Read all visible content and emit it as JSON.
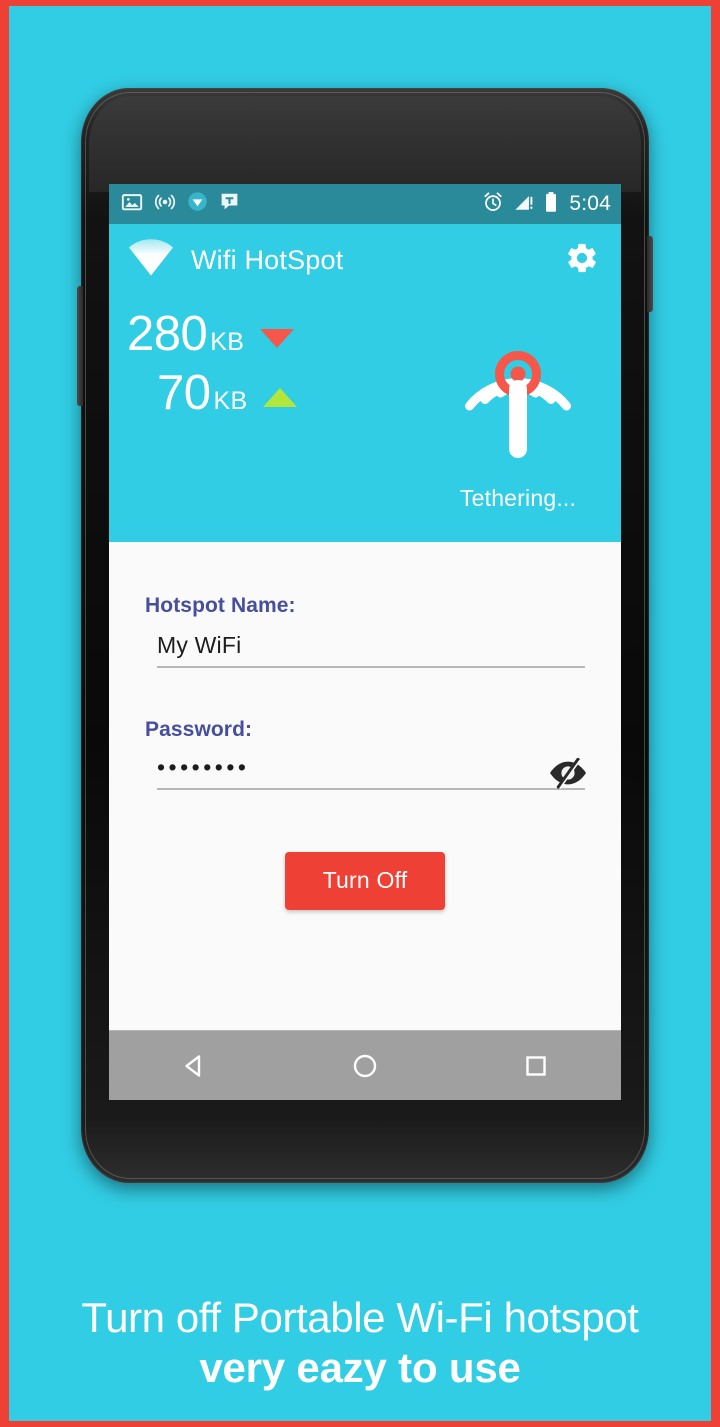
{
  "frame": {
    "border_color": "#EE4035",
    "background_color": "#31CDE4"
  },
  "status_bar": {
    "background_color": "#2B8A99",
    "time": "5:04",
    "left_icons": [
      {
        "name": "image-icon",
        "label": "Screenshot"
      },
      {
        "name": "hotspot-icon",
        "label": "Portable hotspot active"
      },
      {
        "name": "wifi-circle-icon",
        "label": "Wi-Fi"
      },
      {
        "name": "chat-t-icon",
        "label": "T message"
      }
    ],
    "right_icons": [
      {
        "name": "alarm-icon",
        "label": "Alarm set"
      },
      {
        "name": "signal-warning-icon",
        "label": "Mobile signal, no service"
      },
      {
        "name": "battery-icon",
        "label": "Battery"
      }
    ]
  },
  "app_bar": {
    "title": "Wifi HotSpot",
    "logo_icon": "wifi-triangle-icon",
    "settings_icon": "gear-icon",
    "background_color": "#31CDE4"
  },
  "hero": {
    "download": {
      "value": "280",
      "unit": "KB",
      "direction": "down",
      "arrow_color": "#F5574B"
    },
    "upload": {
      "value": "70",
      "unit": "KB",
      "direction": "up",
      "arrow_color": "#B2E63C"
    },
    "broadcast_icon": "broadcast-antenna-icon",
    "broadcast_center_color": "#F5574B",
    "status_text": "Tethering..."
  },
  "form": {
    "hotspot_name": {
      "label": "Hotspot Name:",
      "value": "My WiFi",
      "placeholder": "Hotspot Name"
    },
    "password": {
      "label": "Password:",
      "value": "••••••••",
      "placeholder": "Password",
      "masked": true,
      "toggle_icon": "eye-slash-icon"
    },
    "primary_button": {
      "label": "Turn Off",
      "color": "#EE4035"
    },
    "label_color": "#464E9E",
    "background_color": "#fafafa"
  },
  "nav_bar": {
    "background_color": "#a0a0a0",
    "buttons": [
      {
        "name": "nav-back-button",
        "icon": "back-triangle-icon"
      },
      {
        "name": "nav-home-button",
        "icon": "home-circle-icon"
      },
      {
        "name": "nav-recents-button",
        "icon": "recents-square-icon"
      }
    ]
  },
  "caption": {
    "line1": "Turn off Portable Wi-Fi hotspot",
    "line2": "very eazy to use"
  }
}
